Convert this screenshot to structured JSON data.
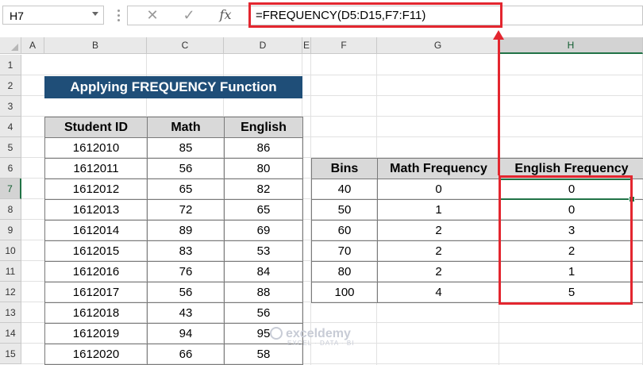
{
  "formula_bar": {
    "name_box": "H7",
    "cancel_icon": "✕",
    "enter_icon": "✓",
    "fx_label": "fx",
    "formula": "=FREQUENCY(D5:D15,F7:F11)"
  },
  "columns": [
    "A",
    "B",
    "C",
    "D",
    "E",
    "F",
    "G",
    "H"
  ],
  "rows": [
    "1",
    "2",
    "3",
    "4",
    "5",
    "6",
    "7",
    "8",
    "9",
    "10",
    "11",
    "12",
    "13",
    "14",
    "15"
  ],
  "selected": {
    "column": "H",
    "row": "7"
  },
  "title": "Applying FREQUENCY Function",
  "student_table": {
    "headers": [
      "Student ID",
      "Math",
      "English"
    ],
    "rows": [
      [
        "1612010",
        "85",
        "86"
      ],
      [
        "1612011",
        "56",
        "80"
      ],
      [
        "1612012",
        "65",
        "82"
      ],
      [
        "1612013",
        "72",
        "65"
      ],
      [
        "1612014",
        "89",
        "69"
      ],
      [
        "1612015",
        "83",
        "53"
      ],
      [
        "1612016",
        "76",
        "84"
      ],
      [
        "1612017",
        "56",
        "88"
      ],
      [
        "1612018",
        "43",
        "56"
      ],
      [
        "1612019",
        "94",
        "95"
      ],
      [
        "1612020",
        "66",
        "58"
      ]
    ]
  },
  "freq_table": {
    "headers": [
      "Bins",
      "Math Frequency",
      "English Frequency"
    ],
    "rows": [
      [
        "40",
        "0",
        "0"
      ],
      [
        "50",
        "1",
        "0"
      ],
      [
        "60",
        "2",
        "3"
      ],
      [
        "70",
        "2",
        "2"
      ],
      [
        "80",
        "2",
        "1"
      ],
      [
        "100",
        "4",
        "5"
      ]
    ]
  },
  "watermark": {
    "name": "exceldemy",
    "tagline": "EXCEL · DATA · BI"
  },
  "colors": {
    "accent_red": "#e3262f",
    "title_bg": "#1f4e78",
    "excel_green": "#217346",
    "header_gray": "#d9d9d9"
  }
}
